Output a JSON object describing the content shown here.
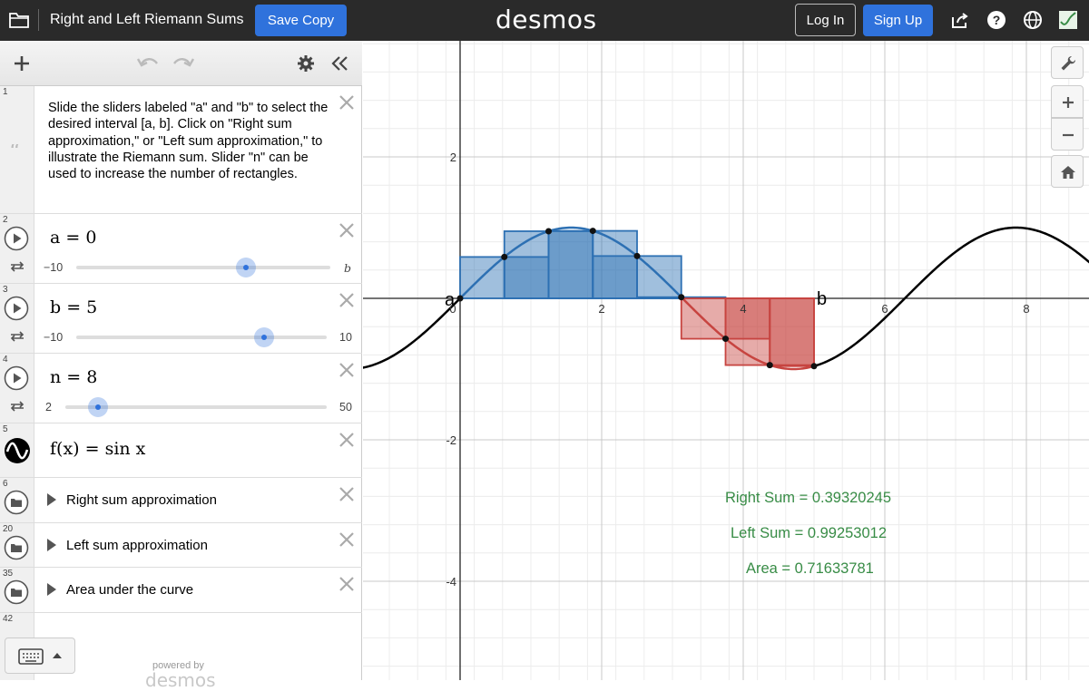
{
  "topbar": {
    "title": "Right and Left Riemann Sums",
    "save_label": "Save Copy",
    "logo": "desmos",
    "login_label": "Log In",
    "signup_label": "Sign Up"
  },
  "expressions": {
    "note": {
      "number": "1",
      "text": "Slide the sliders labeled \"a\" and \"b\" to select the desired interval [a, b]. Click on \"Right sum approximation,\" or \"Left sum approximation,\"  to illustrate the Riemann sum. Slider \"n\" can be used to increase the number of rectangles."
    },
    "slider_a": {
      "number": "2",
      "math": "a = 0",
      "min": "−10",
      "max": "b",
      "value": 0,
      "range": [
        -10,
        5
      ]
    },
    "slider_b": {
      "number": "3",
      "math": "b = 5",
      "min": "−10",
      "max": "10",
      "value": 5,
      "range": [
        -10,
        10
      ]
    },
    "slider_n": {
      "number": "4",
      "math": "n = 8",
      "min": "2",
      "max": "50",
      "value": 8,
      "range": [
        2,
        50
      ]
    },
    "function": {
      "number": "5",
      "math": "f(x) = sin x"
    },
    "folders": [
      {
        "number": "6",
        "label": "Right sum approximation"
      },
      {
        "number": "20",
        "label": "Left sum approximation"
      },
      {
        "number": "35",
        "label": "Area under the curve"
      }
    ],
    "empty_number": "42"
  },
  "powered_by": "powered by",
  "powered_logo": "desmos",
  "graph": {
    "x_ticks": [
      "2",
      "4",
      "6",
      "8"
    ],
    "x_origin_label": "0",
    "y_ticks": [
      "2",
      "-2",
      "-4"
    ],
    "point_a_label": "a",
    "point_b_label": "b",
    "right_sum": "Right Sum = 0.39320245",
    "left_sum": "Left Sum = 0.99253012",
    "area": "Area = 0.71633781",
    "colors": {
      "blue": "#2d70b3",
      "red": "#c74440",
      "green": "#388c46",
      "curve": "#000000"
    }
  }
}
